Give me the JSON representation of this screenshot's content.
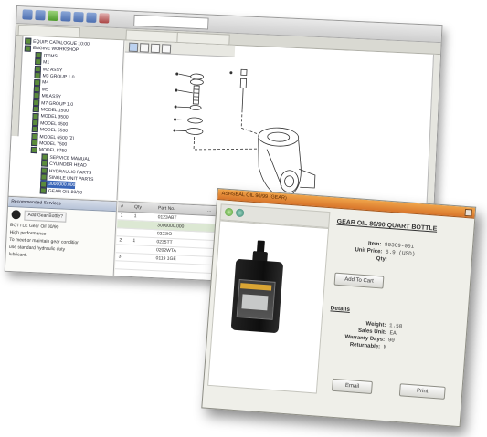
{
  "back_window": {
    "address_text": "",
    "tree": {
      "header": "",
      "items": [
        {
          "label": "EQUIP. CATALOGUE 10:00"
        },
        {
          "label": "ENGINE WORKSHOP"
        },
        {
          "label": "ITEMS"
        },
        {
          "label": "M1"
        },
        {
          "label": "M2 ASSY"
        },
        {
          "label": "M3 GROUP 1.0"
        },
        {
          "label": "M4"
        },
        {
          "label": "M5"
        },
        {
          "label": "M6 ASSY"
        },
        {
          "label": "M7 GROUP 1.0"
        },
        {
          "label": "MODEL 1500"
        },
        {
          "label": "MODEL 3500"
        },
        {
          "label": "MODEL 4500"
        },
        {
          "label": "MODEL 5500"
        },
        {
          "label": "MODEL 6500 (2)"
        },
        {
          "label": "MODEL 7500"
        },
        {
          "label": "MODEL 8750"
        },
        {
          "label": "SERVICE MANUAL"
        },
        {
          "label": "CYLINDER HEAD"
        },
        {
          "label": "HYDRAULIC PARTS"
        },
        {
          "label": "SINGLE UNIT PARTS"
        },
        {
          "label": "3000000.000"
        },
        {
          "label": "GEAR OIL 80/90"
        }
      ],
      "selected_index": 21
    },
    "help_panel": {
      "tab_label": "Recommended Services",
      "question": "Add Gear Bottle?",
      "lines": [
        "BOTTLE  Gear Oil 80/90",
        "High performance",
        "To meet or maintain gear condition",
        "use standard hydraulic duty",
        "lubricant."
      ]
    },
    "grid": {
      "headers": [
        "#",
        "Qty",
        "Part No.",
        "..."
      ],
      "rows": [
        {
          "cells": [
            "1",
            "1",
            "0123ABT",
            ""
          ]
        },
        {
          "cells": [
            "",
            "",
            "3000000.000",
            ""
          ],
          "highlight": true
        },
        {
          "cells": [
            "",
            "",
            "0223IO",
            ""
          ]
        },
        {
          "cells": [
            "2",
            "1",
            "0235TT",
            ""
          ]
        },
        {
          "cells": [
            "",
            "",
            "0202WTA",
            ""
          ]
        },
        {
          "cells": [
            "3",
            "",
            "0119 1GE",
            ""
          ]
        },
        {
          "cells": [
            "",
            "",
            "",
            ""
          ]
        },
        {
          "cells": [
            "",
            "",
            "",
            ""
          ]
        }
      ]
    }
  },
  "dialog": {
    "title": "ASHSEAL OIL 90/99 (GEAR)",
    "product_title": "GEAR OIL 80/90 QUART BOTTLE",
    "item_label": "Item:",
    "item_value": "80309-001",
    "unit_price_label": "Unit Price:",
    "unit_price_value": "6.9 (USD)",
    "qty_label": "Qty:",
    "add_to_cart_label": "Add To Cart",
    "details_heading": "Details",
    "weight_label": "Weight:",
    "weight_value": "1.50",
    "sales_unit_label": "Sales Unit:",
    "sales_unit_value": "EA",
    "warranty_days_label": "Warranty Days:",
    "warranty_days_value": "90",
    "returnable_label": "Returnable:",
    "returnable_value": "N",
    "email_label": "Email",
    "print_label": "Print",
    "icons": [
      "green-arrow-icon",
      "add-icon"
    ]
  },
  "colors": {
    "title_orange": "#e08a3a",
    "selection_blue": "#3a66b8",
    "grid_highlight": "#dce8d3"
  }
}
